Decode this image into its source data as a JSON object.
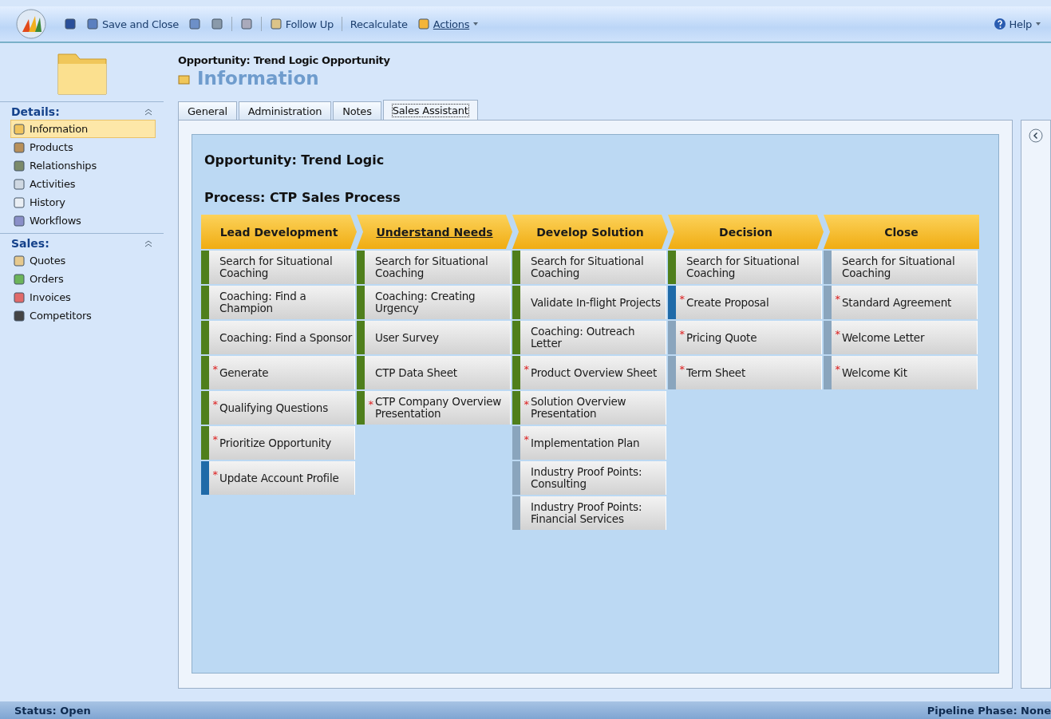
{
  "toolbar": {
    "items": [
      {
        "kind": "icon"
      },
      {
        "kind": "button",
        "label": "Save and Close"
      },
      {
        "kind": "icon"
      },
      {
        "kind": "icon"
      },
      {
        "kind": "separator"
      },
      {
        "kind": "icon"
      },
      {
        "kind": "separator"
      },
      {
        "kind": "button",
        "label": "Follow Up"
      },
      {
        "kind": "separator"
      },
      {
        "kind": "button",
        "label": "Recalculate"
      },
      {
        "kind": "menu",
        "label": "Actions"
      }
    ],
    "help": "Help"
  },
  "header": {
    "entity": "Opportunity: Trend Logic Opportunity",
    "title": "Information"
  },
  "sidebar": {
    "sections": [
      {
        "title": "Details:",
        "items": [
          {
            "label": "Information",
            "selected": true
          },
          {
            "label": "Products",
            "selected": false
          },
          {
            "label": "Relationships",
            "selected": false
          },
          {
            "label": "Activities",
            "selected": false
          },
          {
            "label": "History",
            "selected": false
          },
          {
            "label": "Workflows",
            "selected": false
          }
        ]
      },
      {
        "title": "Sales:",
        "items": [
          {
            "label": "Quotes",
            "selected": false
          },
          {
            "label": "Orders",
            "selected": false
          },
          {
            "label": "Invoices",
            "selected": false
          },
          {
            "label": "Competitors",
            "selected": false
          }
        ]
      }
    ]
  },
  "tabs": [
    {
      "label": "General",
      "selected": false
    },
    {
      "label": "Administration",
      "selected": false
    },
    {
      "label": "Notes",
      "selected": false
    },
    {
      "label": "Sales Assistant",
      "selected": true
    }
  ],
  "assistant": {
    "opportunity": "Opportunity: Trend Logic",
    "process": "Process: CTP Sales Process",
    "stages": [
      {
        "title": "Lead Development",
        "selected": false,
        "steps": [
          {
            "label": "Search for Situational Coaching",
            "color": "#4f7f1c"
          },
          {
            "label": "Coaching: Find a Champion",
            "color": "#4f7f1c"
          },
          {
            "label": "Coaching: Find a Sponsor",
            "color": "#4f7f1c"
          },
          {
            "label": "Generate",
            "color": "#4f7f1c",
            "mark": "*"
          },
          {
            "label": "Qualifying Questions",
            "color": "#4f7f1c",
            "mark": "*"
          },
          {
            "label": "Prioritize Opportunity",
            "color": "#4f7f1c",
            "mark": "*"
          },
          {
            "label": "Update Account Profile",
            "color": "#1f6aa8",
            "mark": "*"
          }
        ]
      },
      {
        "title": "Understand Needs",
        "selected": true,
        "steps": [
          {
            "label": "Search for Situational Coaching",
            "color": "#4f7f1c"
          },
          {
            "label": "Coaching: Creating Urgency",
            "color": "#4f7f1c"
          },
          {
            "label": "User Survey",
            "color": "#4f7f1c"
          },
          {
            "label": "CTP Data Sheet",
            "color": "#4f7f1c"
          },
          {
            "label": "CTP Company Overview Presentation",
            "color": "#4f7f1c",
            "mark": "*"
          }
        ]
      },
      {
        "title": "Develop Solution",
        "selected": false,
        "steps": [
          {
            "label": "Search for Situational Coaching",
            "color": "#4f7f1c"
          },
          {
            "label": "Validate In-flight Projects",
            "color": "#4f7f1c"
          },
          {
            "label": "Coaching: Outreach Letter",
            "color": "#4f7f1c"
          },
          {
            "label": "Product Overview Sheet",
            "color": "#4f7f1c",
            "mark": "*"
          },
          {
            "label": "Solution Overview Presentation",
            "color": "#4f7f1c",
            "mark": "*"
          },
          {
            "label": "Implementation Plan",
            "color": "#8aa5bd",
            "mark": "*"
          },
          {
            "label": "Industry Proof Points: Consulting",
            "color": "#8aa5bd"
          },
          {
            "label": "Industry Proof Points: Financial Services",
            "color": "#8aa5bd"
          }
        ]
      },
      {
        "title": "Decision",
        "selected": false,
        "steps": [
          {
            "label": "Search for Situational Coaching",
            "color": "#4f7f1c"
          },
          {
            "label": "Create Proposal",
            "color": "#1f6aa8",
            "mark": "*"
          },
          {
            "label": "Pricing Quote",
            "color": "#8aa5bd",
            "mark": "*"
          },
          {
            "label": "Term Sheet",
            "color": "#8aa5bd",
            "mark": "*"
          }
        ]
      },
      {
        "title": "Close",
        "selected": false,
        "steps": [
          {
            "label": "Search for Situational Coaching",
            "color": "#8aa5bd"
          },
          {
            "label": "Standard Agreement",
            "color": "#8aa5bd",
            "mark": "*"
          },
          {
            "label": "Welcome Letter",
            "color": "#8aa5bd",
            "mark": "*"
          },
          {
            "label": "Welcome Kit",
            "color": "#8aa5bd",
            "mark": "*"
          }
        ]
      }
    ]
  },
  "status_bar": {
    "status": "Status: Open",
    "pipeline": "Pipeline Phase: None"
  }
}
